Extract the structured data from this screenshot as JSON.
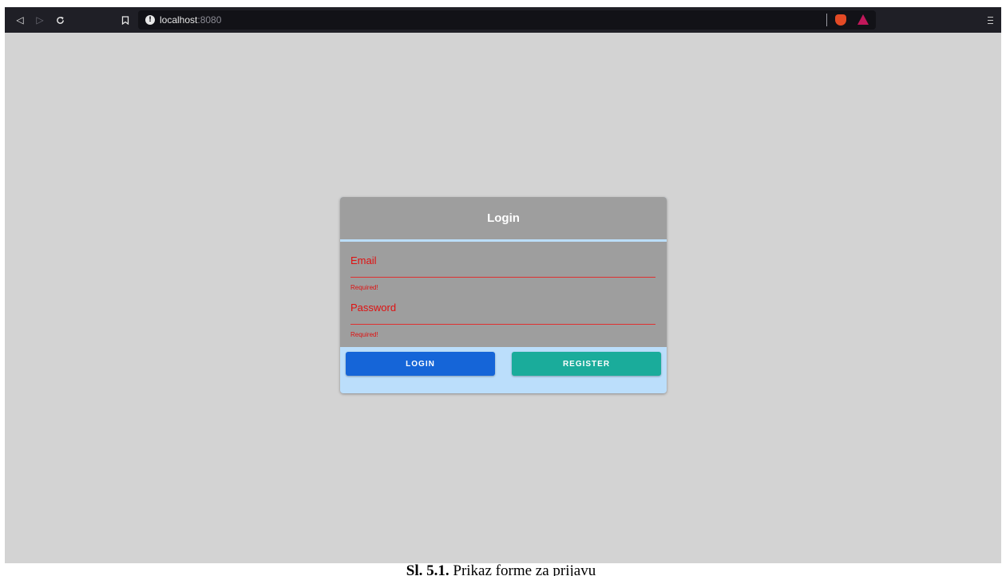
{
  "browser": {
    "url_host": "localhost",
    "url_port": ":8080",
    "icons": [
      "back-icon",
      "forward-icon",
      "reload-icon",
      "bookmark-icon",
      "site-info-icon",
      "brave-shields-icon",
      "brave-rewards-icon",
      "menu-icon"
    ]
  },
  "login_form": {
    "title": "Login",
    "email_label": "Email",
    "email_error": "Required!",
    "password_label": "Password",
    "password_error": "Required!",
    "login_button": "LOGIN",
    "register_button": "REGISTER"
  },
  "caption": {
    "number": "Sl. 5.1.",
    "text": " Prikaz forme za prijavu"
  },
  "colors": {
    "page_background": "#d3d3d3",
    "card_header": "#9e9e9e",
    "card_accent": "#bbdefb",
    "error": "#e01010",
    "login_button": "#1565d8",
    "register_button": "#1aac9b"
  }
}
